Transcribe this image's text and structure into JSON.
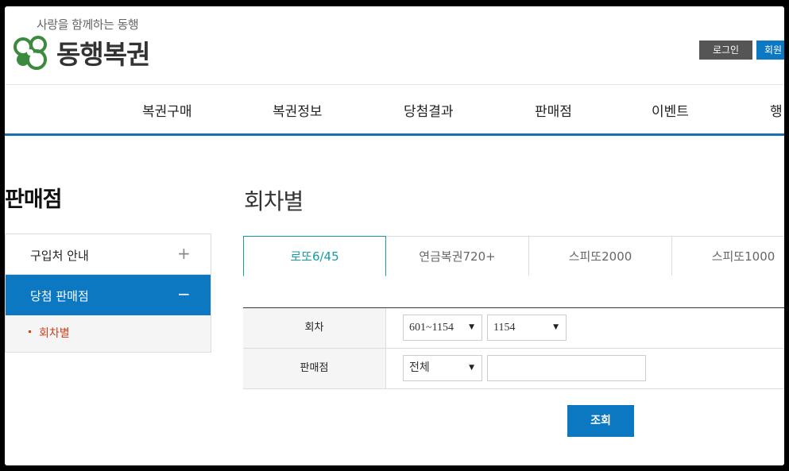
{
  "header": {
    "slogan": "사랑을 함께하는 동행",
    "logo_text": "동행복권",
    "login_label": "로그인",
    "join_label": "회원"
  },
  "gnb": {
    "items": [
      "복권구매",
      "복권정보",
      "당첨결과",
      "판매점",
      "이벤트",
      "행"
    ]
  },
  "sidebar": {
    "title": "판매점",
    "items": [
      {
        "label": "구입처 안내",
        "symbol": "+"
      },
      {
        "label": "당첨 판매점",
        "symbol": "−"
      }
    ],
    "sub_item": "회차별"
  },
  "main": {
    "title": "회차별",
    "tabs": [
      "로또6/45",
      "연금복권720+",
      "스피또2000",
      "스피또1000"
    ],
    "form": {
      "round_label": "회차",
      "round_range": "601~1154",
      "round_value": "1154",
      "store_label": "판매점",
      "store_region": "전체",
      "store_input": ""
    },
    "search_label": "조회"
  },
  "colors": {
    "accent": "#0b78c1",
    "tab_accent": "#149d9e",
    "sub_highlight": "#c9421b"
  },
  "icons": {
    "dropdown": "triangle-down-icon",
    "logo": "clover-logo-icon"
  }
}
